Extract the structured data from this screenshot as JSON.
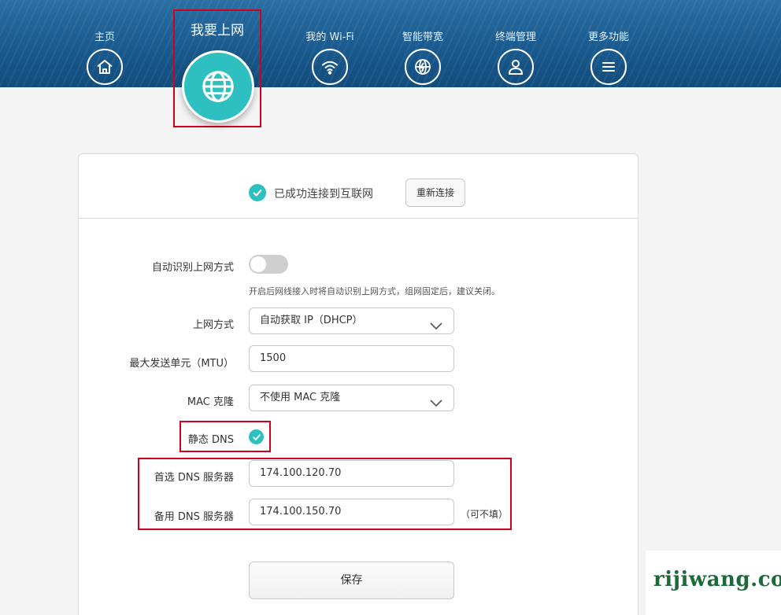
{
  "nav": {
    "items": [
      {
        "label": "主页",
        "icon": "home-icon"
      },
      {
        "label": "我要上网",
        "icon": "globe-icon",
        "active": true
      },
      {
        "label": "我的 Wi-Fi",
        "icon": "wifi-icon"
      },
      {
        "label": "智能带宽",
        "icon": "bandwidth-globe-icon"
      },
      {
        "label": "终端管理",
        "icon": "user-icon"
      },
      {
        "label": "更多功能",
        "icon": "menu-icon"
      }
    ]
  },
  "status": {
    "text": "已成功连接到互联网",
    "reconnect_label": "重新连接"
  },
  "form": {
    "auto_detect": {
      "label": "自动识别上网方式",
      "enabled": false,
      "hint": "开启后网线接入时将自动识别上网方式，组网固定后，建议关闭。"
    },
    "wan_mode": {
      "label": "上网方式",
      "value": "自动获取 IP（DHCP）"
    },
    "mtu": {
      "label": "最大发送单元（MTU）",
      "value": "1500"
    },
    "mac_clone": {
      "label": "MAC 克隆",
      "value": "不使用 MAC 克隆"
    },
    "static_dns": {
      "label": "静态 DNS",
      "checked": true
    },
    "primary_dns": {
      "label": "首选 DNS 服务器",
      "value": "174.100.120.70"
    },
    "secondary_dns": {
      "label": "备用 DNS 服务器",
      "value": "174.100.150.70",
      "note": "（可不填）"
    },
    "save_label": "保存"
  },
  "watermark": "rijiwang.com",
  "colors": {
    "header": "#1a5a8e",
    "accent": "#2ebfc0",
    "highlight": "#d0021b"
  }
}
